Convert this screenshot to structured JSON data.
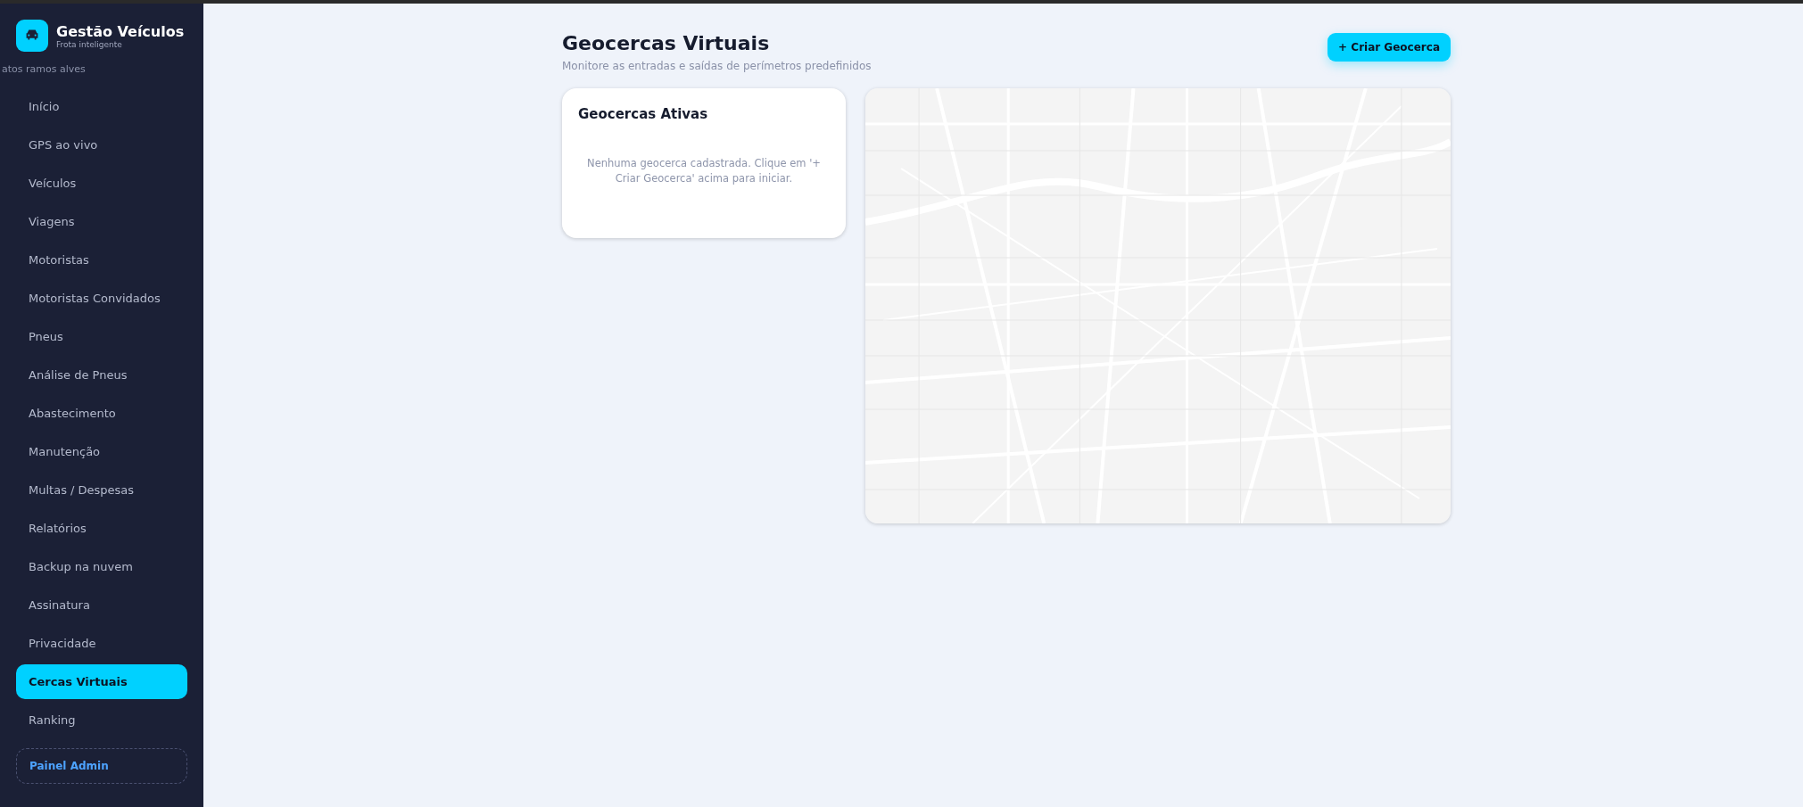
{
  "brand": {
    "title": "Gestão Veículos",
    "subtitle": "Frota inteligente"
  },
  "user": "atos ramos alves",
  "sidebar": {
    "items": [
      {
        "label": "Início",
        "selected": false
      },
      {
        "label": "GPS ao vivo",
        "selected": false
      },
      {
        "label": "Veículos",
        "selected": false
      },
      {
        "label": "Viagens",
        "selected": false
      },
      {
        "label": "Motoristas",
        "selected": false
      },
      {
        "label": "Motoristas Convidados",
        "selected": false
      },
      {
        "label": "Pneus",
        "selected": false
      },
      {
        "label": "Análise de Pneus",
        "selected": false
      },
      {
        "label": "Abastecimento",
        "selected": false
      },
      {
        "label": "Manutenção",
        "selected": false
      },
      {
        "label": "Multas / Despesas",
        "selected": false
      },
      {
        "label": "Relatórios",
        "selected": false
      },
      {
        "label": "Backup na nuvem",
        "selected": false
      },
      {
        "label": "Assinatura",
        "selected": false
      },
      {
        "label": "Privacidade",
        "selected": false
      },
      {
        "label": "Cercas Virtuais",
        "selected": true
      },
      {
        "label": "Ranking",
        "selected": false
      }
    ],
    "admin_button": "Painel Admin"
  },
  "page": {
    "title": "Geocercas Virtuais",
    "subtitle": "Monitore as entradas e saídas de perímetros predefinidos",
    "create_button": "+ Criar Geocerca"
  },
  "active_card": {
    "title": "Geocercas Ativas",
    "empty_message": "Nenhuma geocerca cadastrada. Clique em '+ Criar Geocerca' acima para iniciar."
  }
}
